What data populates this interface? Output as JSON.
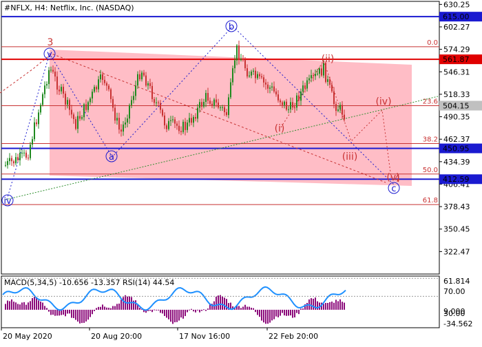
{
  "chart_title": "#NFLX, H4:  Netflix, Inc. (NASDAQ)",
  "indicator_title": "MACD(5,34,5) -10.656 -13.357 RSI(14) 44.54",
  "colors": {
    "background": "#ffffff",
    "bull": "#1f8a1f",
    "bear": "#c83232",
    "blue_line": "#1a1ad0",
    "red_line": "#e00000",
    "zone": "#ff9aa8",
    "macd_hist": "#8b0a7a",
    "rsi_line": "#1e90ff",
    "trend_green": "#2f8f2f"
  },
  "chart_data": {
    "type": "candlestick",
    "symbol": "NFLX",
    "timeframe": "H4",
    "y_ticks": [
      "630.25",
      "602.27",
      "574.29",
      "546.31",
      "518.33",
      "490.35",
      "462.37",
      "434.39",
      "406.41",
      "378.43",
      "350.45",
      "322.47"
    ],
    "x_ticks": [
      "20 May 2020",
      "20 Aug 20:00",
      "17 Nov 16:00",
      "22 Feb 20:00"
    ],
    "ylim": [
      294.49,
      634.0
    ],
    "price_labels": [
      {
        "text": "615.00",
        "value": 615.0,
        "color": "#1a1ad0"
      },
      {
        "text": "561.87",
        "value": 561.87,
        "color": "#e00000"
      },
      {
        "text": "504.15",
        "value": 504.15,
        "color": "#c0c0c0"
      },
      {
        "text": "450.95",
        "value": 450.95,
        "color": "#1a1ad0"
      },
      {
        "text": "412.59",
        "value": 412.59,
        "color": "#1a1ad0"
      }
    ],
    "fib_levels": [
      {
        "label": "0.0",
        "value": 577.5
      },
      {
        "label": "23.6",
        "value": 504.15
      },
      {
        "label": "38.2",
        "value": 457.0
      },
      {
        "label": "50.0",
        "value": 419.0
      },
      {
        "label": "61.8",
        "value": 381.0
      }
    ],
    "wave_labels": {
      "red": [
        "3",
        "4",
        "(i)",
        "(ii)",
        "(iii)",
        "(iv)",
        "(v)"
      ],
      "blue": [
        "a",
        "b",
        "c",
        "v",
        "iv"
      ]
    },
    "indicator_y_ticks": [
      "61.814",
      "70.00",
      "9.000",
      "30.00",
      "-34.562"
    ],
    "indicator_ylim": [
      -40,
      75
    ]
  }
}
